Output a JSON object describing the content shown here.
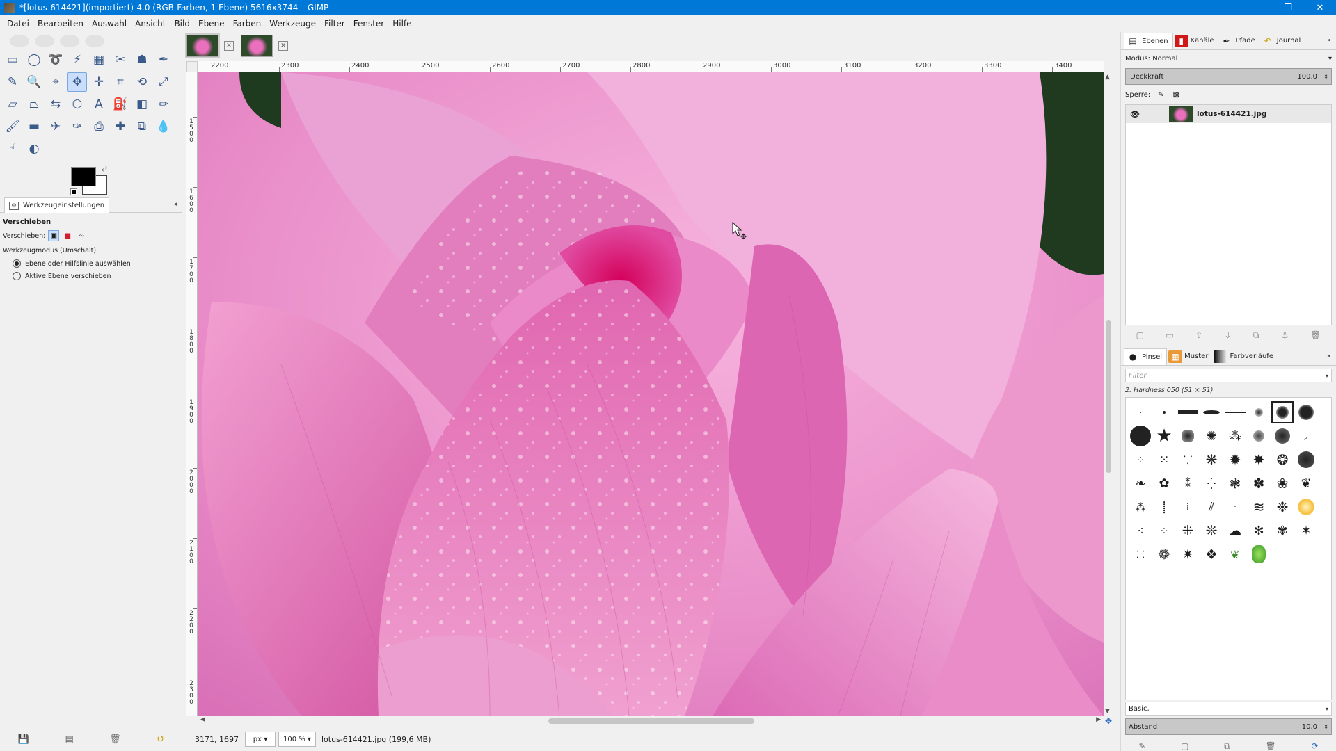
{
  "window": {
    "title": "*[lotus-614421](importiert)-4.0 (RGB-Farben, 1 Ebene) 5616x3744 – GIMP",
    "controls": [
      "–",
      "❐",
      "✕"
    ]
  },
  "menu": [
    "Datei",
    "Bearbeiten",
    "Auswahl",
    "Ansicht",
    "Bild",
    "Ebene",
    "Farben",
    "Werkzeuge",
    "Filter",
    "Fenster",
    "Hilfe"
  ],
  "tool_options": {
    "tab_label": "Werkzeugeinstellungen",
    "tool_name": "Verschieben",
    "move_label": "Verschieben:",
    "mode_label": "Werkzeugmodus (Umschalt)",
    "options": [
      {
        "label": "Ebene oder Hilfslinie auswählen",
        "checked": true
      },
      {
        "label": "Aktive Ebene verschieben",
        "checked": false
      }
    ]
  },
  "ruler": {
    "h_labels": [
      "2200",
      "2300",
      "2400",
      "2500",
      "2600",
      "2700",
      "2800",
      "2900",
      "3000",
      "3100",
      "3200",
      "3300",
      "3400"
    ],
    "v_labels": [
      "1500",
      "1600",
      "1700",
      "1800",
      "1900",
      "2000",
      "2100",
      "2200",
      "2300"
    ]
  },
  "status": {
    "coords": "3171, 1697",
    "unit": "px",
    "zoom": "100 %",
    "file": "lotus-614421.jpg (199,6 MB)"
  },
  "layers_dock": {
    "tabs": [
      "Ebenen",
      "Kanäle",
      "Pfade",
      "Journal"
    ],
    "mode": "Modus: Normal",
    "opacity_label": "Deckkraft",
    "opacity_value": "100,0",
    "lock_label": "Sperre:",
    "layer_name": "lotus-614421.jpg"
  },
  "brushes_dock": {
    "tabs": [
      "Pinsel",
      "Muster",
      "Farbverläufe"
    ],
    "filter_placeholder": "Filter",
    "brush_name": "2. Hardness 050 (51 × 51)",
    "preset": "Basic,",
    "spacing_label": "Abstand",
    "spacing_value": "10,0"
  },
  "colors": {
    "foreground": "#000000",
    "background": "#ffffff",
    "accent": "#0078d7"
  }
}
